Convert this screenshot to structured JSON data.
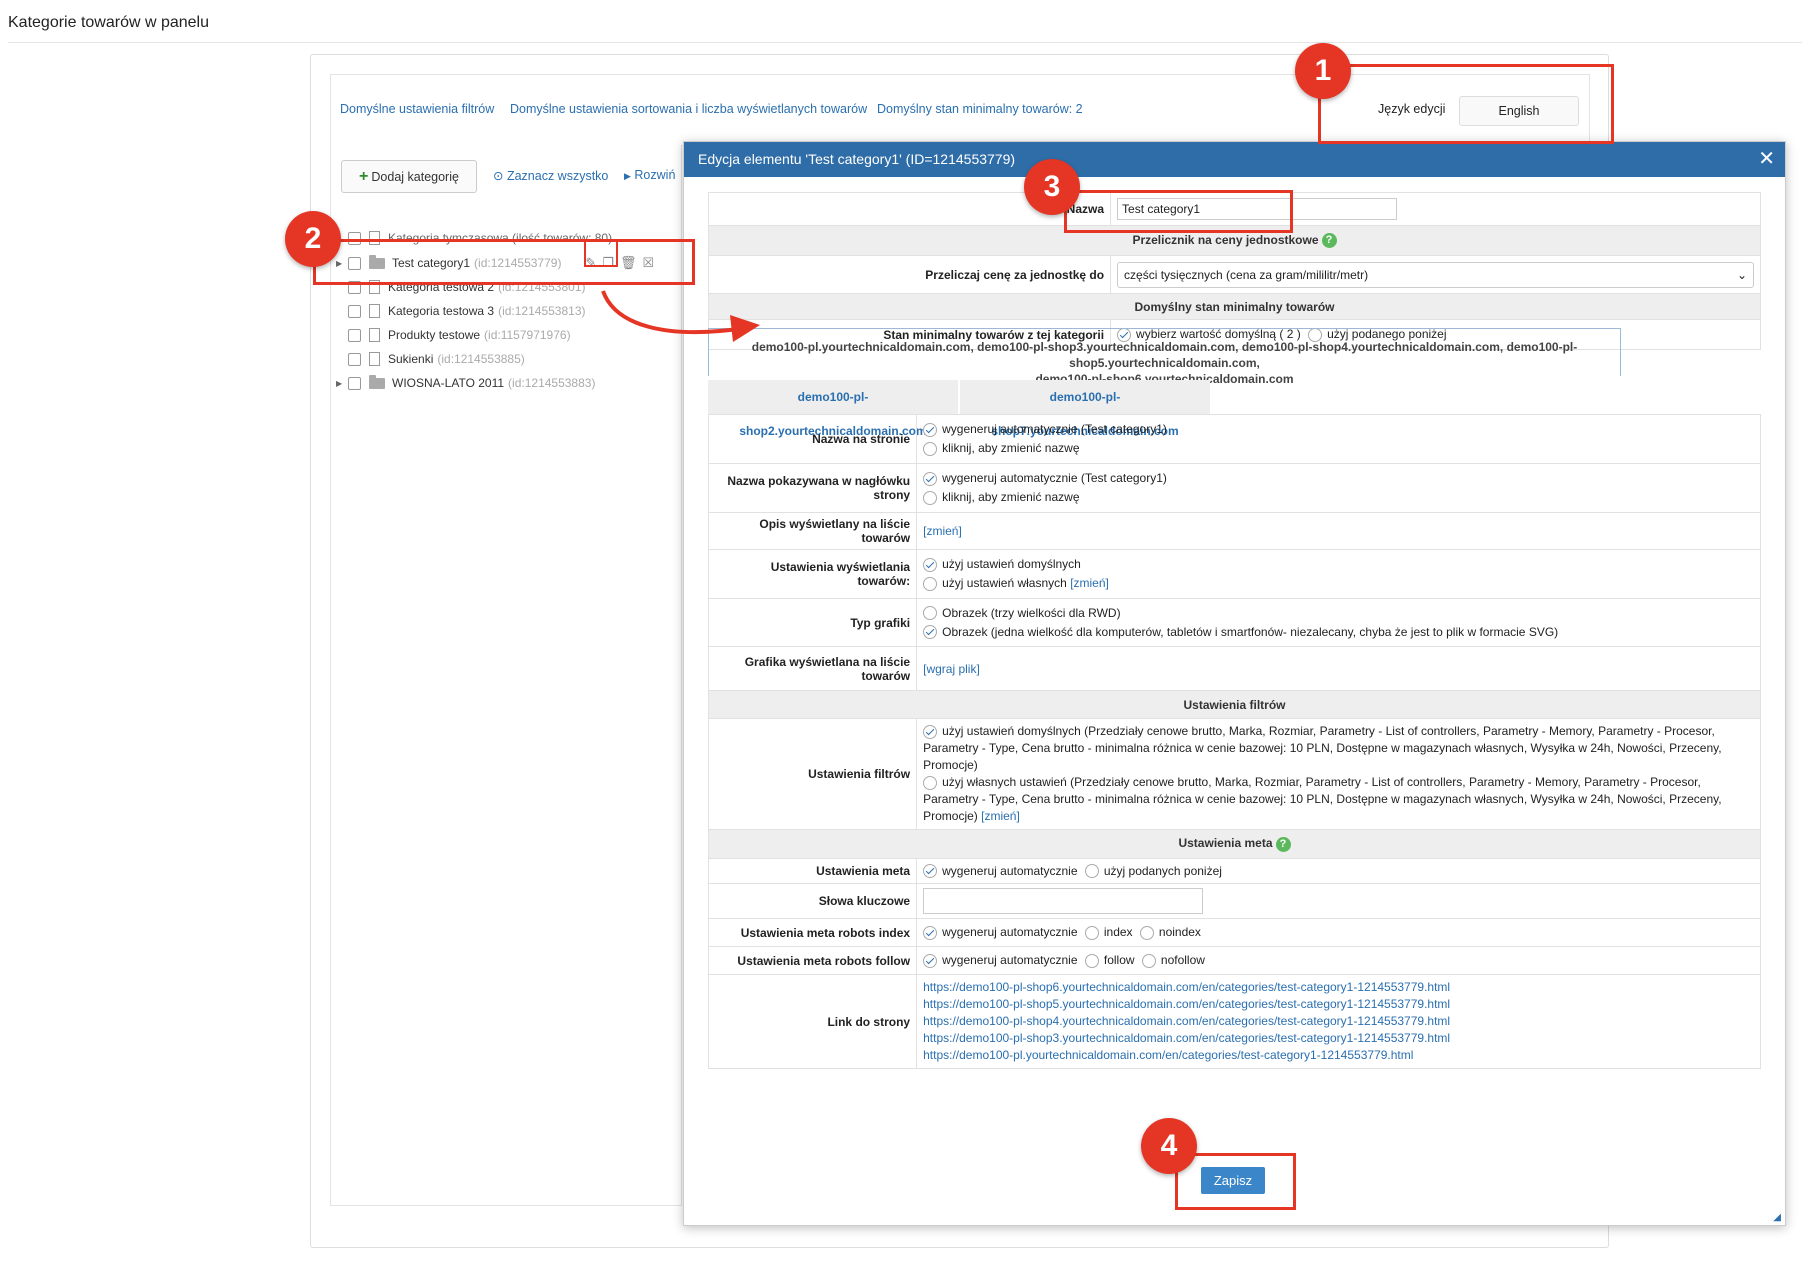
{
  "page": {
    "title": "Kategorie towarów w panelu"
  },
  "top_links": [
    "Domyślne ustawienia filtrów",
    "Domyślne ustawienia sortowania i liczba wyświetlanych towarów",
    "Domyślny stan minimalny towarów: 2"
  ],
  "language": {
    "label": "Język edycji",
    "value": "English"
  },
  "toolbar": {
    "add_label": "Dodaj kategorię",
    "select_all": "Zaznacz wszystko",
    "expand": "Rozwiń"
  },
  "tree": [
    {
      "name": "Kategoria tymczasowa (ilość towarów: 80)",
      "id": ""
    },
    {
      "name": "Test category1",
      "id": "(id:1214553779)"
    },
    {
      "name": "Kategoria testowa 2",
      "id": "(id:1214553801)"
    },
    {
      "name": "Kategoria testowa 3",
      "id": "(id:1214553813)"
    },
    {
      "name": "Produkty testowe",
      "id": "(id:1157971976)"
    },
    {
      "name": "Sukienki",
      "id": "(id:1214553885)"
    },
    {
      "name": "WIOSNA-LATO 2011",
      "id": "(id:1214553883)"
    }
  ],
  "dialog": {
    "title": "Edycja elementu 'Test category1' (ID=1214553779)",
    "close": "✕",
    "name_label": "Nazwa",
    "name_value": "Test category1",
    "sec_unit": "Przelicznik na ceny jednostkowe",
    "unit_label": "Przeliczaj cenę za jednostkę do",
    "unit_value": "części tysięcznych (cena za gram/mililitr/metr)",
    "sec_min": "Domyślny stan minimalny towarów",
    "min_label": "Stan minimalny towarów z tej kategorii",
    "min_opt1": "wybierz wartość domyślną ( 2 )",
    "min_opt2": "użyj podanego poniżej",
    "shops_line1": "demo100-pl.yourtechnicaldomain.com, demo100-pl-shop3.yourtechnicaldomain.com, demo100-pl-shop4.yourtechnicaldomain.com, demo100-pl-shop5.yourtechnicaldomain.com,",
    "shops_line2": "demo100-pl-shop6.yourtechnicaldomain.com",
    "tab1": "demo100-pl-shop2.yourtechnicaldomain.com",
    "tab2": "demo100-pl-shop7.yourtechnicaldomain.com",
    "page_name_label": "Nazwa na stronie",
    "page_name_opt1": "wygeneruj automatycznie (Test category1)",
    "page_name_opt2": "kliknij, aby zmienić nazwę",
    "header_name_label1": "Nazwa pokazywana w nagłówku",
    "header_name_label2": "strony",
    "header_name_opt1": "wygeneruj automatycznie (Test category1)",
    "header_name_opt2": "kliknij, aby zmienić nazwę",
    "desc_label": "Opis wyświetlany na liście towarów",
    "change_link": "[zmień]",
    "display_label": "Ustawienia wyświetlania towarów:",
    "display_opt1": "użyj ustawień domyślnych",
    "display_opt2": "użyj ustawień własnych",
    "img_type_label": "Typ grafiki",
    "img_type_opt1": "Obrazek (trzy wielkości dla RWD)",
    "img_type_opt2": "Obrazek (jedna wielkość dla komputerów, tabletów i smartfonów- niezalecany, chyba że jest to plik w formacie SVG)",
    "img_label1": "Grafika wyświetlana na liście",
    "img_label2": "towarów",
    "upload_link": "[wgraj plik]",
    "sec_filters": "Ustawienia filtrów",
    "filters_label": "Ustawienia filtrów",
    "filters_opt1": "użyj ustawień domyślnych (Przedziały cenowe brutto, Marka, Rozmiar, Parametry - List of controllers, Parametry - Memory, Parametry - Procesor, Parametry - Type, Cena brutto - minimalna różnica w cenie bazowej: 10 PLN, Dostępne w magazynach własnych, Wysyłka w 24h, Nowości, Przeceny, Promocje)",
    "filters_opt2": "użyj własnych ustawień (Przedziały cenowe brutto, Marka, Rozmiar, Parametry - List of controllers, Parametry - Memory, Parametry - Procesor, Parametry - Type, Cena brutto - minimalna różnica w cenie bazowej: 10 PLN, Dostępne w magazynach własnych, Wysyłka w 24h, Nowości, Przeceny, Promocje)",
    "sec_meta": "Ustawienia meta",
    "meta_label": "Ustawienia meta",
    "meta_opt1": "wygeneruj automatycznie",
    "meta_opt2": "użyj podanych poniżej",
    "keywords_label": "Słowa kluczowe",
    "robots_index_label": "Ustawienia meta robots index",
    "robots_follow_label": "Ustawienia meta robots follow",
    "auto": "wygeneruj automatycznie",
    "index": "index",
    "noindex": "noindex",
    "follow": "follow",
    "nofollow": "nofollow",
    "link_label": "Link do strony",
    "links": [
      "https://demo100-pl-shop6.yourtechnicaldomain.com/en/categories/test-category1-1214553779.html",
      "https://demo100-pl-shop5.yourtechnicaldomain.com/en/categories/test-category1-1214553779.html",
      "https://demo100-pl-shop4.yourtechnicaldomain.com/en/categories/test-category1-1214553779.html",
      "https://demo100-pl-shop3.yourtechnicaldomain.com/en/categories/test-category1-1214553779.html",
      "https://demo100-pl.yourtechnicaldomain.com/en/categories/test-category1-1214553779.html"
    ],
    "save": "Zapisz"
  },
  "badges": [
    "1",
    "2",
    "3",
    "4"
  ],
  "colors": {
    "accent": "#2f6da8",
    "annotation": "#e53524",
    "link": "#2a6fb0"
  }
}
